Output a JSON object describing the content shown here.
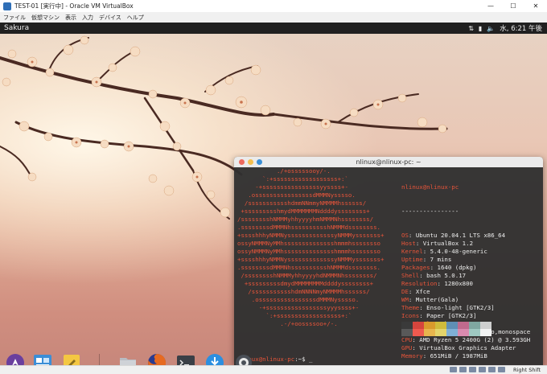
{
  "window": {
    "title": "TEST-01 [実行中] - Oracle VM VirtualBox",
    "minimize": "—",
    "maximize": "☐",
    "close": "✕"
  },
  "menubar": [
    "ファイル",
    "仮想マシン",
    "表示",
    "入力",
    "デバイス",
    "ヘルプ"
  ],
  "panel": {
    "workspace": "Sakura",
    "clock": "水, 6:21 午後"
  },
  "terminal": {
    "title": "nlinux@nlinux-pc: ~",
    "logo": [
      "           ./+osssssooy/-.",
      "       `:+ssssssssssssssssss+:`",
      "     -+ssssssssssssssssyyssss+-",
      "   .ossssssssssssssssdMMMNysssso.",
      "  /ssssssssssshdmmNNmmyNMMMMhssssss/",
      " +ssssssssshmydMMMMMMMNddddyssssssss+",
      "/sssssssshNMMMyhhyyyyhmNMMMNhssssssss/",
      ".ssssssssdMMMNhsssssssssshNMMMdssssssss.",
      "+sssshhhyNMMNysssssssssssssyNMMMysssssss+",
      "ossyNMMMNyMMhsssssssssssssshmmmhssssssso",
      "ossyNMMMNyMMhsssssssssssssshmmmhssssssso",
      "+sssshhhyNMMNysssssssssssssyNMMMysssssss+",
      ".ssssssssdMMMNhsssssssssshNMMMdssssssss.",
      " /sssssssshNMMMyhhyyyyhdNMMMNhssssssss/",
      "  +sssssssssdmydMMMMMMMMddddyssssssss+",
      "   /ssssssssssshdmNNNNmyNMMMMhssssss/",
      "    .ossssssssssssssssdMMMNysssso.",
      "      -+sssssssssssssssssyyyssss+-",
      "        `:+ssssssssssssssssss+:`",
      "            .-/+oossssoo+/-."
    ],
    "user_host": "nlinux@nlinux-pc",
    "separator": "----------------",
    "info": [
      {
        "k": "OS",
        "v": "Ubuntu 20.04.1 LTS x86_64"
      },
      {
        "k": "Host",
        "v": "VirtualBox 1.2"
      },
      {
        "k": "Kernel",
        "v": "5.4.0-48-generic"
      },
      {
        "k": "Uptime",
        "v": "7 mins"
      },
      {
        "k": "Packages",
        "v": "1640 (dpkg)"
      },
      {
        "k": "Shell",
        "v": "bash 5.0.17"
      },
      {
        "k": "Resolution",
        "v": "1280x800"
      },
      {
        "k": "DE",
        "v": "Xfce"
      },
      {
        "k": "WM",
        "v": "Mutter(Gala)"
      },
      {
        "k": "Theme",
        "v": "Enso-light [GTK2/3]"
      },
      {
        "k": "Icons",
        "v": "Paper [GTK2/3]"
      },
      {
        "k": "Terminal",
        "v": "sakura"
      },
      {
        "k": "Terminal Font",
        "v": "Ubuntu Mono,monospace"
      },
      {
        "k": "CPU",
        "v": "AMD Ryzen 5 2400G (2) @ 3.593GH"
      },
      {
        "k": "GPU",
        "v": "VirtualBox Graphics Adapter"
      },
      {
        "k": "Memory",
        "v": "651MiB / 1987MiB"
      }
    ],
    "prompt": "nlinux@nlinux-pc",
    "prompt_suffix": ":~$ _",
    "palette_row1": [
      "#3a3a3a",
      "#d6453d",
      "#d99a2c",
      "#cfbb3b",
      "#5f8fb5",
      "#c06a8d",
      "#7fa7a1",
      "#cfcfcf"
    ],
    "palette_row2": [
      "#595959",
      "#ef5a4f",
      "#e7b54e",
      "#e3d46b",
      "#7fb0d6",
      "#d98aae",
      "#9fc9c2",
      "#f2f2f2"
    ]
  },
  "dock": [
    {
      "name": "launcher",
      "color": "#6a3f9e"
    },
    {
      "name": "window-manager",
      "color": "#3c8ed6"
    },
    {
      "name": "notes",
      "color": "#f4c742"
    },
    {
      "name": "files",
      "color": "#b9bcc2"
    },
    {
      "name": "firefox",
      "color": "#e66a21"
    },
    {
      "name": "terminal",
      "color": "#3a3f46"
    },
    {
      "name": "downloads",
      "color": "#2c8fe0"
    },
    {
      "name": "settings",
      "color": "#4a4f57"
    }
  ],
  "statusbar": {
    "hostkey": "Right Shift"
  }
}
